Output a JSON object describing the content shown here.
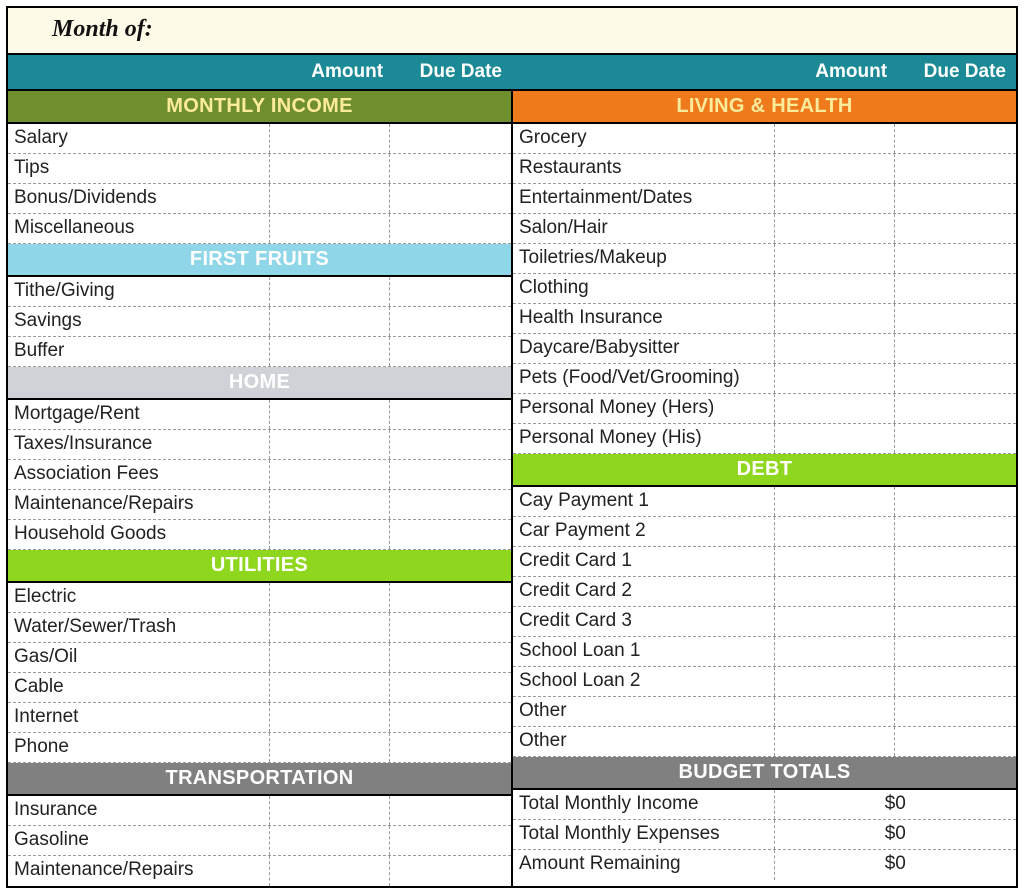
{
  "title": "Month of:",
  "headers": {
    "amount": "Amount",
    "due": "Due Date"
  },
  "left": {
    "sections": [
      {
        "title": "MONTHLY INCOME",
        "style": "sh-olive",
        "rows": [
          {
            "label": "Salary",
            "amount": "",
            "due": ""
          },
          {
            "label": "Tips",
            "amount": "",
            "due": ""
          },
          {
            "label": "Bonus/Dividends",
            "amount": "",
            "due": ""
          },
          {
            "label": "Miscellaneous",
            "amount": "",
            "due": ""
          }
        ]
      },
      {
        "title": "FIRST FRUITS",
        "style": "sh-sky",
        "rows": [
          {
            "label": "Tithe/Giving",
            "amount": "",
            "due": ""
          },
          {
            "label": "Savings",
            "amount": "",
            "due": ""
          },
          {
            "label": "Buffer",
            "amount": "",
            "due": ""
          }
        ]
      },
      {
        "title": "HOME",
        "style": "sh-silver",
        "rows": [
          {
            "label": "Mortgage/Rent",
            "amount": "",
            "due": ""
          },
          {
            "label": "Taxes/Insurance",
            "amount": "",
            "due": ""
          },
          {
            "label": "Association Fees",
            "amount": "",
            "due": ""
          },
          {
            "label": "Maintenance/Repairs",
            "amount": "",
            "due": ""
          },
          {
            "label": "Household Goods",
            "amount": "",
            "due": ""
          }
        ]
      },
      {
        "title": "UTILITIES",
        "style": "sh-lime",
        "rows": [
          {
            "label": "Electric",
            "amount": "",
            "due": ""
          },
          {
            "label": "Water/Sewer/Trash",
            "amount": "",
            "due": ""
          },
          {
            "label": "Gas/Oil",
            "amount": "",
            "due": ""
          },
          {
            "label": "Cable",
            "amount": "",
            "due": ""
          },
          {
            "label": "Internet",
            "amount": "",
            "due": ""
          },
          {
            "label": "Phone",
            "amount": "",
            "due": ""
          }
        ]
      },
      {
        "title": "TRANSPORTATION",
        "style": "sh-gray",
        "rows": [
          {
            "label": "Insurance",
            "amount": "",
            "due": ""
          },
          {
            "label": "Gasoline",
            "amount": "",
            "due": ""
          },
          {
            "label": "Maintenance/Repairs",
            "amount": "",
            "due": ""
          }
        ]
      }
    ]
  },
  "right": {
    "sections": [
      {
        "title": "LIVING & HEALTH",
        "style": "sh-orange",
        "rows": [
          {
            "label": "Grocery",
            "amount": "",
            "due": ""
          },
          {
            "label": "Restaurants",
            "amount": "",
            "due": ""
          },
          {
            "label": "Entertainment/Dates",
            "amount": "",
            "due": ""
          },
          {
            "label": "Salon/Hair",
            "amount": "",
            "due": ""
          },
          {
            "label": "Toiletries/Makeup",
            "amount": "",
            "due": ""
          },
          {
            "label": "Clothing",
            "amount": "",
            "due": ""
          },
          {
            "label": "Health Insurance",
            "amount": "",
            "due": ""
          },
          {
            "label": "Daycare/Babysitter",
            "amount": "",
            "due": ""
          },
          {
            "label": "Pets (Food/Vet/Grooming)",
            "amount": "",
            "due": ""
          },
          {
            "label": "Personal Money (Hers)",
            "amount": "",
            "due": ""
          },
          {
            "label": "Personal Money (His)",
            "amount": "",
            "due": ""
          }
        ]
      },
      {
        "title": "DEBT",
        "style": "sh-limed",
        "rows": [
          {
            "label": "Cay Payment 1",
            "amount": "",
            "due": ""
          },
          {
            "label": "Car Payment 2",
            "amount": "",
            "due": ""
          },
          {
            "label": "Credit Card 1",
            "amount": "",
            "due": ""
          },
          {
            "label": "Credit Card 2",
            "amount": "",
            "due": ""
          },
          {
            "label": "Credit Card 3",
            "amount": "",
            "due": ""
          },
          {
            "label": "School Loan 1",
            "amount": "",
            "due": ""
          },
          {
            "label": "School Loan 2",
            "amount": "",
            "due": ""
          },
          {
            "label": "Other",
            "amount": "",
            "due": ""
          },
          {
            "label": "Other",
            "amount": "",
            "due": ""
          }
        ]
      }
    ],
    "totals": {
      "title": "BUDGET TOTALS",
      "style": "sh-grayd",
      "rows": [
        {
          "label": "Total Monthly Income",
          "value": "$0"
        },
        {
          "label": "Total Monthly Expenses",
          "value": "$0"
        },
        {
          "label": "Amount Remaining",
          "value": "$0"
        }
      ]
    }
  }
}
